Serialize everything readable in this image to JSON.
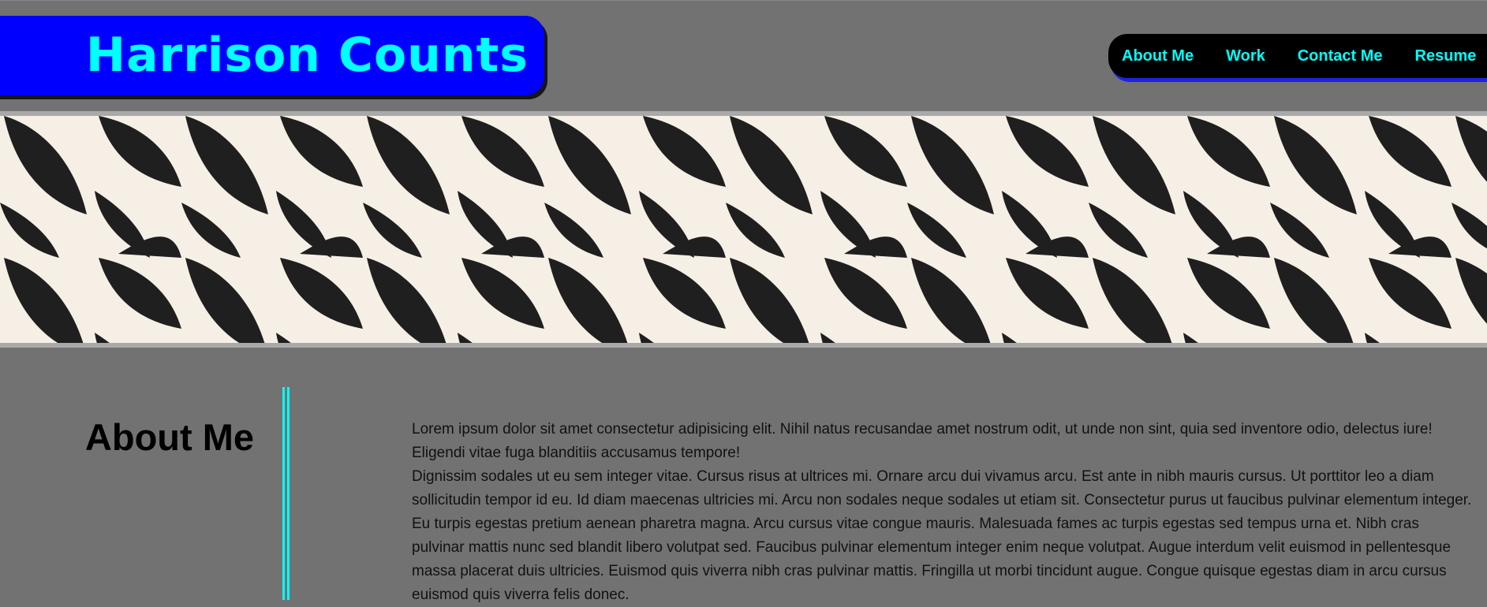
{
  "header": {
    "title": "Harrison Counts",
    "nav": [
      "About Me",
      "Work",
      "Contact Me",
      "Resume"
    ]
  },
  "banner": {
    "pattern": "leaf-pattern",
    "colors": {
      "leaf": "#1f1f1f",
      "background": "#f6efe6",
      "border": "#a9a9a9"
    }
  },
  "about": {
    "heading": "About Me",
    "paragraphs": [
      "Lorem ipsum dolor sit amet consectetur adipisicing elit. Nihil natus recusandae amet nostrum odit, ut unde non sint, quia sed inventore odio, delectus iure! Eligendi vitae fuga blanditiis accusamus tempore!",
      "Dignissim sodales ut eu sem integer vitae. Cursus risus at ultrices mi. Ornare arcu dui vivamus arcu. Est ante in nibh mauris cursus. Ut porttitor leo a diam sollicitudin tempor id eu. Id diam maecenas ultricies mi. Arcu non sodales neque sodales ut etiam sit. Consectetur purus ut faucibus pulvinar elementum integer. Eu turpis egestas pretium aenean pharetra magna. Arcu cursus vitae congue mauris. Malesuada fames ac turpis egestas sed tempus urna et. Nibh cras pulvinar mattis nunc sed blandit libero volutpat sed. Faucibus pulvinar elementum integer enim neque volutpat. Augue interdum velit euismod in pellentesque massa placerat duis ultricies. Euismod quis viverra nibh cras pulvinar mattis. Fringilla ut morbi tincidunt augue. Congue quisque egestas diam in arcu cursus euismod quis viverra felis donec."
    ]
  },
  "colors": {
    "page_background": "#727272",
    "brand_background": "#0000ff",
    "accent_cyan": "#00ffff",
    "nav_background": "#000000"
  }
}
